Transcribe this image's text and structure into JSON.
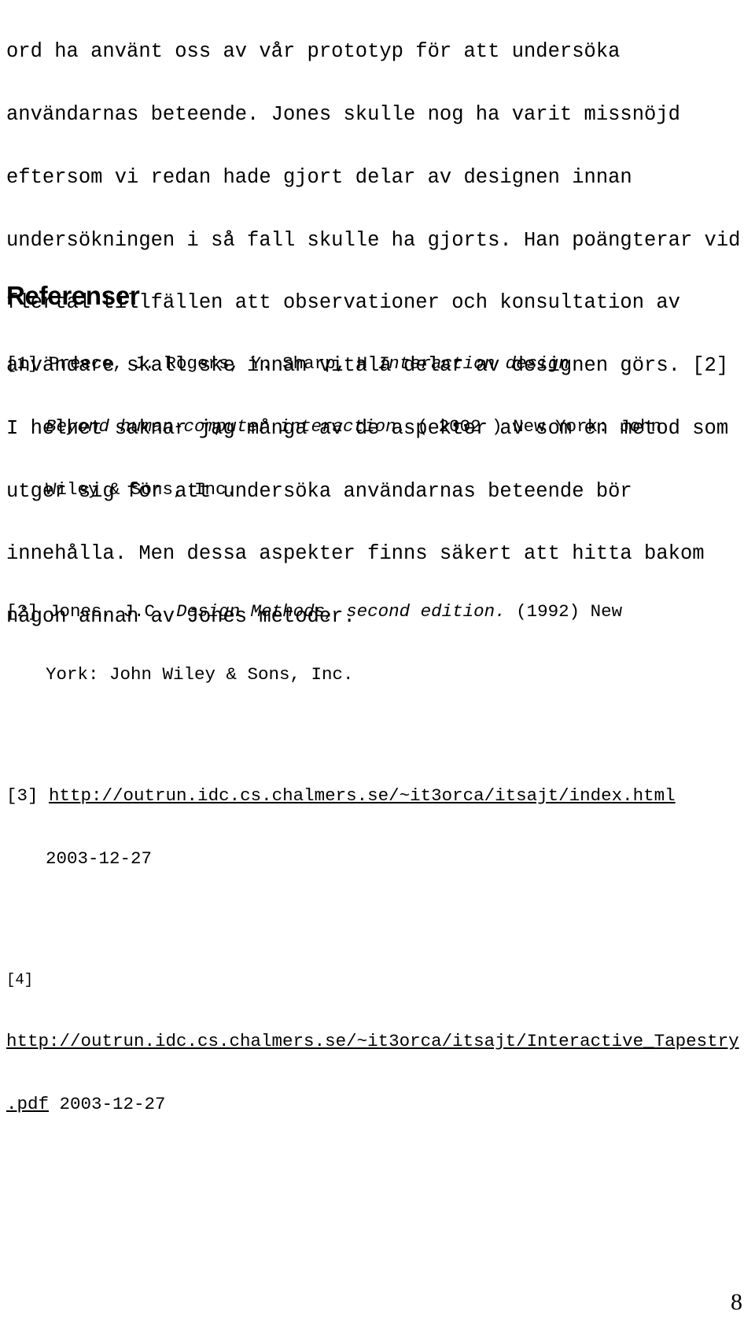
{
  "document": {
    "language": "sv",
    "body_paragraph": {
      "lines": [
        "ord ha använt oss av vår prototyp för att undersöka",
        "användarnas beteende. Jones skulle nog ha varit missnöjd",
        "eftersom vi redan hade gjort delar av designen innan",
        "undersökningen i så fall skulle ha gjorts. Han poängterar vid",
        "flertal tillfällen att observationer och konsultation av",
        "användare skall ske innan vitala delar av designen görs. [2]",
        "I helhet saknar jag många av de aspekter av som en metod som",
        "utger sig för att undersöka användarnas beteende bör",
        "innehålla. Men dessa aspekter finns säkert att hitta bakom",
        "någon annan av Jones metoder."
      ]
    },
    "references_heading": "Referenser",
    "references": [
      {
        "marker": "[1]",
        "line1_plain": "Preece, J. Rogers, Y. Sharp, H ",
        "line1_italic": "Interaction design",
        "line2_italic": "Beyond human-computer interaction.",
        "line2_plain": " ( 2002 ) New York: John",
        "line3_plain": "Wiley & Sons, Inc."
      },
      {
        "marker": "[2]",
        "line1_plain": "Jones, J.C. ",
        "line1_italic": "Design Methods, second edition.",
        "line1_tail": " (1992) New",
        "line2_plain": "York: John Wiley & Sons, Inc."
      },
      {
        "marker": "[3]",
        "url": "http://outrun.idc.cs.chalmers.se/~it3orca/itsajt/index.html",
        "date": "2003-12-27"
      },
      {
        "marker": "[4]",
        "url": "http://outrun.idc.cs.chalmers.se/~it3orca/itsajt/Interactive_Tapestry",
        "url_tail": ".pdf",
        "date": "2003-12-27"
      }
    ],
    "page_number": "8"
  }
}
